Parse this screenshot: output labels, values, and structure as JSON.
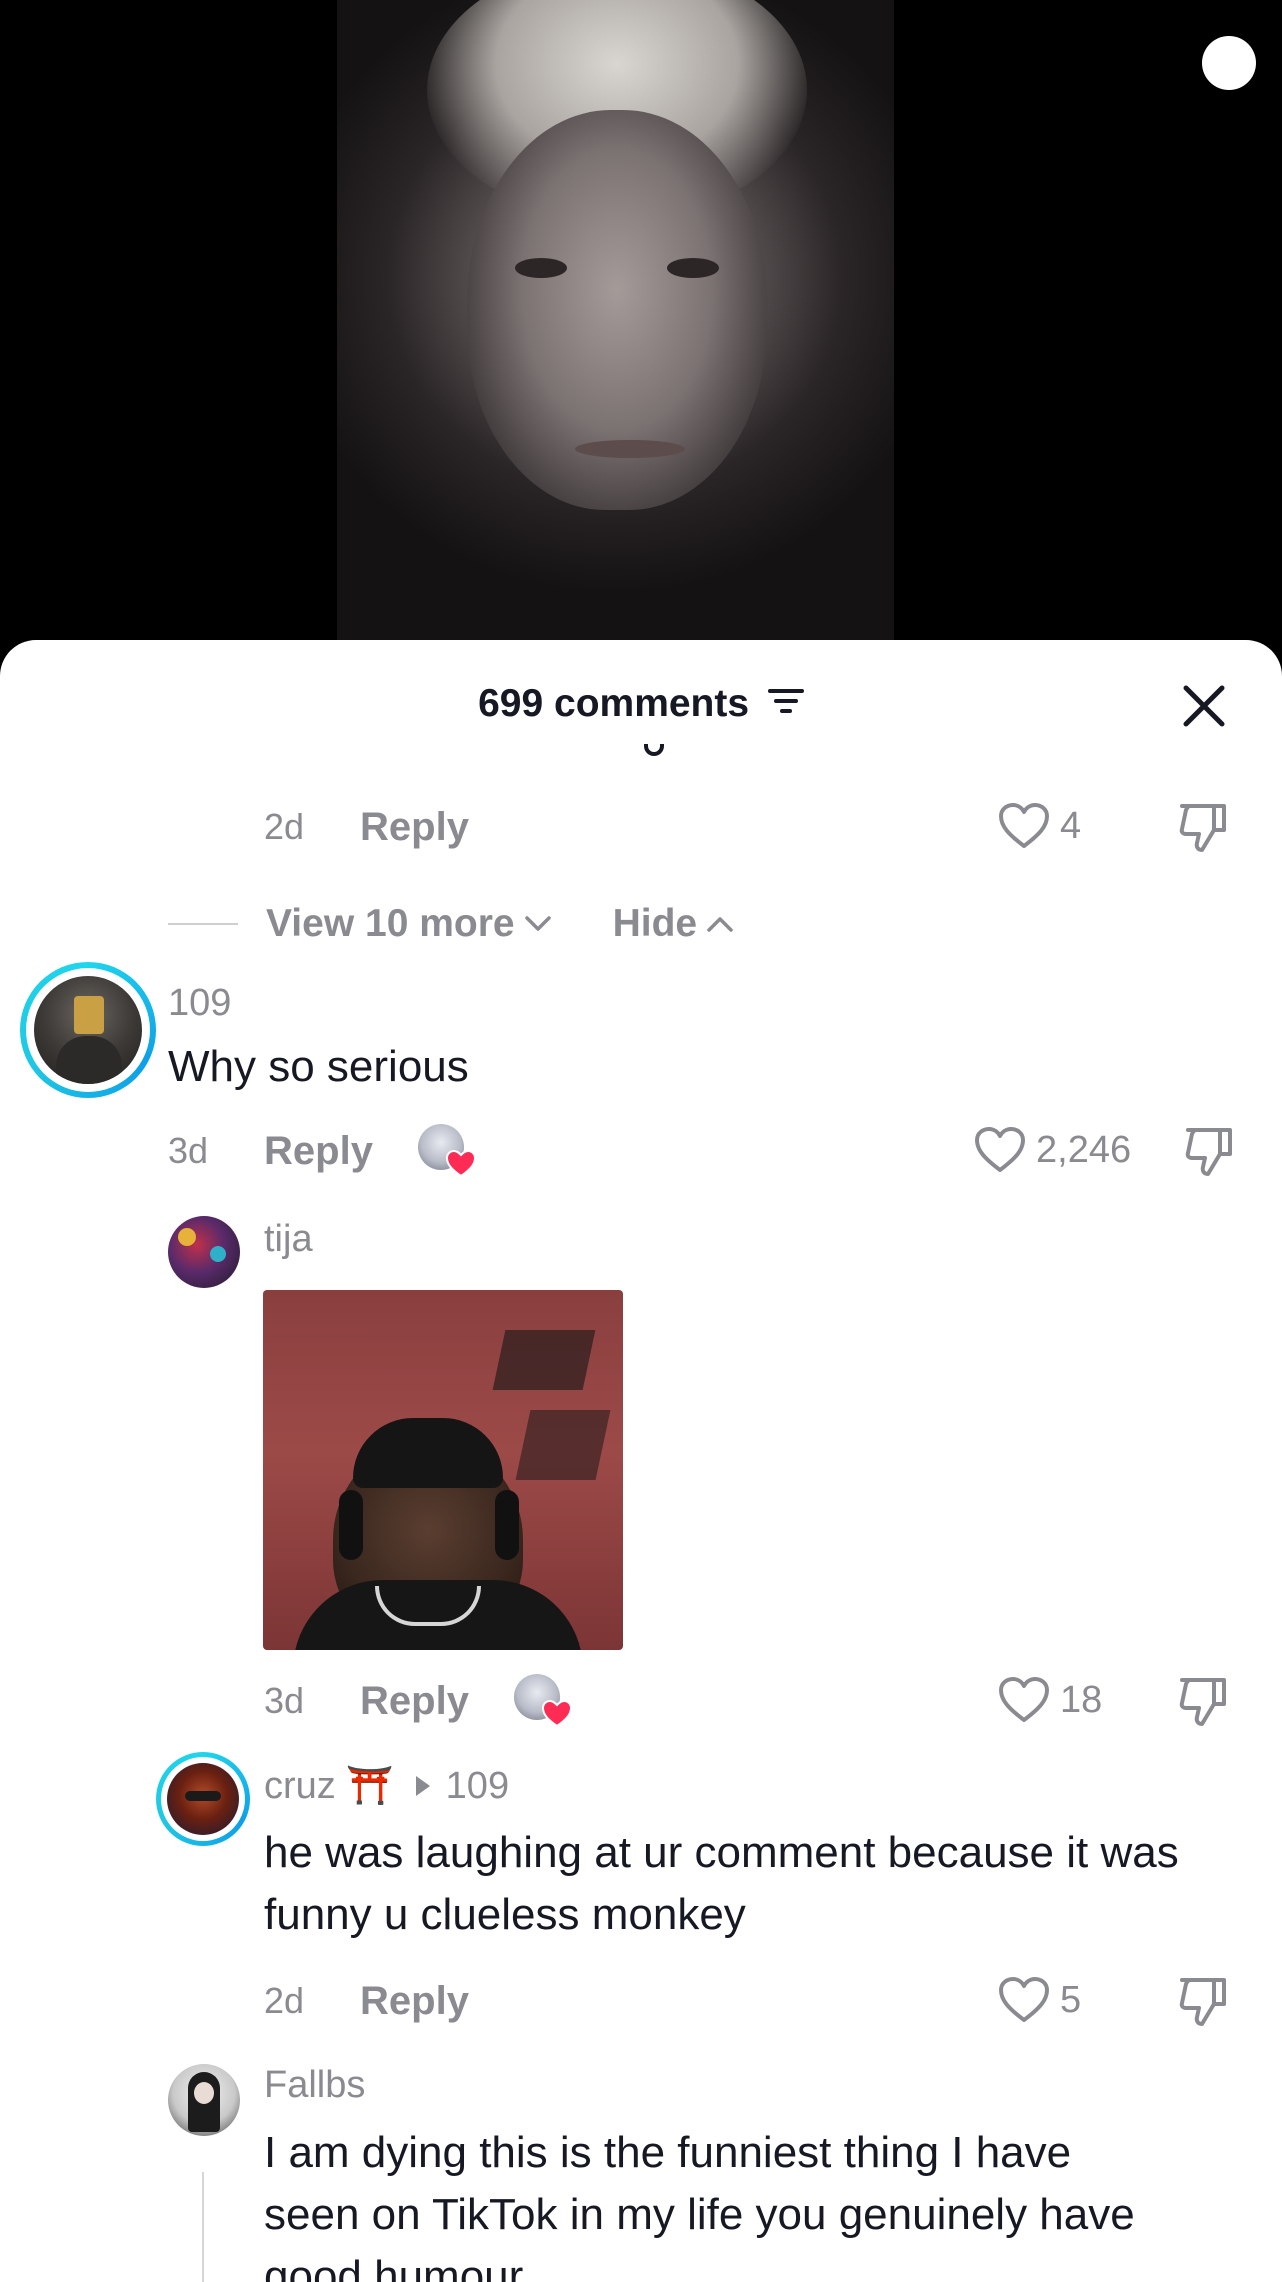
{
  "panel": {
    "comments_count": "699 comments",
    "sort_icon": "sort-filter-icon",
    "close_icon": "close-icon"
  },
  "comments": [
    {
      "id": "top-reply",
      "time": "2d",
      "reply_label": "Reply",
      "likes": "4"
    },
    {
      "id": "view-more",
      "view_more_label": "View 10 more",
      "hide_label": "Hide"
    },
    {
      "id": "comment-109",
      "username": "109",
      "text": "Why so serious",
      "time": "3d",
      "reply_label": "Reply",
      "likes": "2,246"
    },
    {
      "id": "reply-tija",
      "username": "tija",
      "time": "3d",
      "reply_label": "Reply",
      "likes": "18"
    },
    {
      "id": "reply-cruz",
      "username": "cruz ⛩️",
      "reply_to": "109",
      "text_line1": "he was laughing at ur comment because it was",
      "text_line2": "funny u clueless monkey",
      "time": "2d",
      "reply_label": "Reply",
      "likes": "5"
    },
    {
      "id": "reply-fallbs",
      "username": "Fallbs",
      "text_line1": "I am dying this is the funniest thing I have",
      "text_line2": "seen on TikTok in my life you genuinely have",
      "text_line3": "good humour"
    }
  ],
  "colors": {
    "text": "#161823",
    "muted": "#8a8b91",
    "like_heart": "#fe2c55",
    "story_ring_start": "#20d5ec",
    "story_ring_end": "#0e9fe8"
  }
}
